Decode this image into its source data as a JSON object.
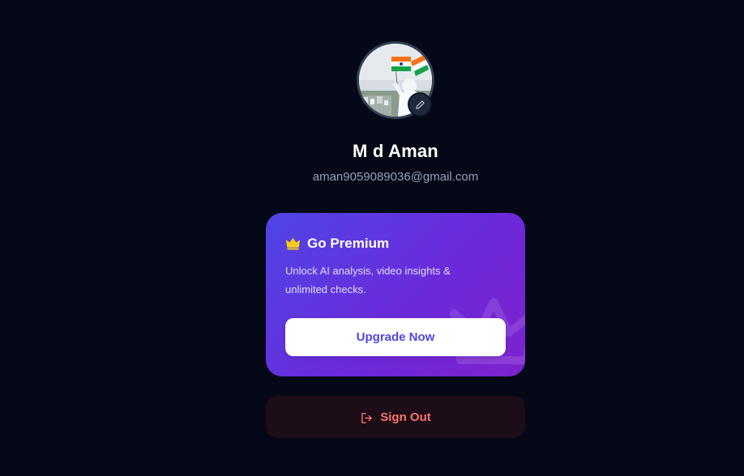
{
  "profile": {
    "name": "M d Aman",
    "email": "aman9059089036@gmail.com",
    "avatar_icon": "profile-photo",
    "edit_icon": "pencil-icon"
  },
  "premium": {
    "title": "Go Premium",
    "title_icon": "crown-icon",
    "description": "Unlock AI analysis, video insights & unlimited checks.",
    "button_label": "Upgrade Now"
  },
  "signout": {
    "label": "Sign Out",
    "icon": "sign-out-icon"
  },
  "colors": {
    "background": "#050816",
    "accent": "#4f46e5",
    "card_gradient_end": "#7e22ce",
    "crown": "#facc15",
    "danger": "#f87171"
  }
}
